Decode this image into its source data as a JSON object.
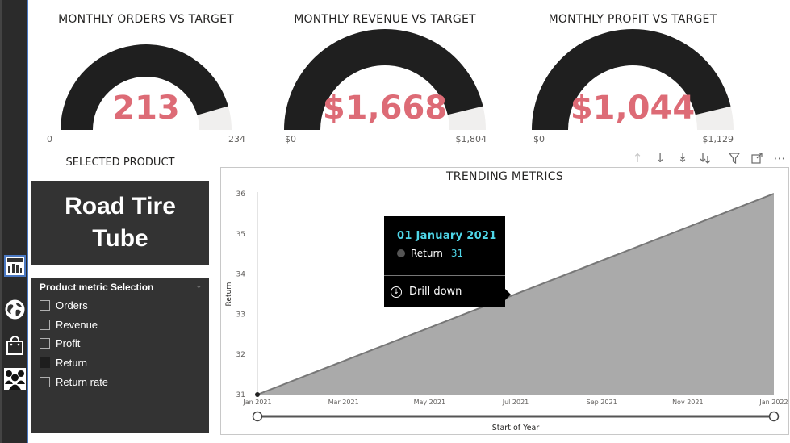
{
  "nav": {
    "items": [
      {
        "icon": "report-icon"
      },
      {
        "icon": "globe-icon"
      },
      {
        "icon": "shopping-bag-icon"
      },
      {
        "icon": "people-icon"
      }
    ]
  },
  "gauges": [
    {
      "title": "MONTHLY ORDERS VS TARGET",
      "value_label": "213",
      "min_label": "0",
      "max_label": "234",
      "value": 213,
      "max": 234
    },
    {
      "title": "MONTHLY REVENUE VS TARGET",
      "value_label": "$1,668",
      "min_label": "$0",
      "max_label": "$1,804",
      "value": 1668,
      "max": 1804
    },
    {
      "title": "MONTHLY PROFIT VS TARGET",
      "value_label": "$1,044",
      "min_label": "$0",
      "max_label": "$1,129",
      "value": 1044,
      "max": 1129
    }
  ],
  "selected_product": {
    "title": "SELECTED PRODUCT",
    "name": "Road Tire Tube"
  },
  "slicer": {
    "header": "Product metric Selection",
    "items": [
      {
        "label": "Orders",
        "checked": false
      },
      {
        "label": "Revenue",
        "checked": false
      },
      {
        "label": "Profit",
        "checked": false
      },
      {
        "label": "Return",
        "checked": true
      },
      {
        "label": "Return rate",
        "checked": false
      }
    ]
  },
  "toolbar": {
    "icons": [
      "drill-up-icon",
      "drill-down-icon",
      "expand-next-level-icon",
      "expand-hierarchy-icon",
      "filter-icon",
      "focus-mode-icon",
      "more-options-icon"
    ]
  },
  "tooltip": {
    "date": "01 January 2021",
    "series_label": "Return",
    "series_value": "31",
    "drill_label": "Drill down"
  },
  "colors": {
    "gauge_fill": "#1f1f1f",
    "gauge_track": "#f0efee",
    "gauge_value": "#dd6b76",
    "area_fill": "#aaaaaa",
    "area_line": "#777777",
    "tooltip_accent": "#4fd6e8"
  },
  "chart_data": {
    "type": "area",
    "title": "TRENDING METRICS",
    "xlabel": "Start of Year",
    "ylabel": "Return",
    "x_ticks": [
      "Jan 2021",
      "Mar 2021",
      "May 2021",
      "Jul 2021",
      "Sep 2021",
      "Nov 2021",
      "Jan 2022"
    ],
    "y_ticks": [
      "31",
      "32",
      "33",
      "34",
      "35",
      "36"
    ],
    "ylim": [
      31,
      36
    ],
    "x": [
      "Jan 2021",
      "Jan 2022"
    ],
    "series": [
      {
        "name": "Return",
        "values": [
          31,
          36
        ]
      }
    ],
    "grid": false,
    "has_range_slider": true
  }
}
